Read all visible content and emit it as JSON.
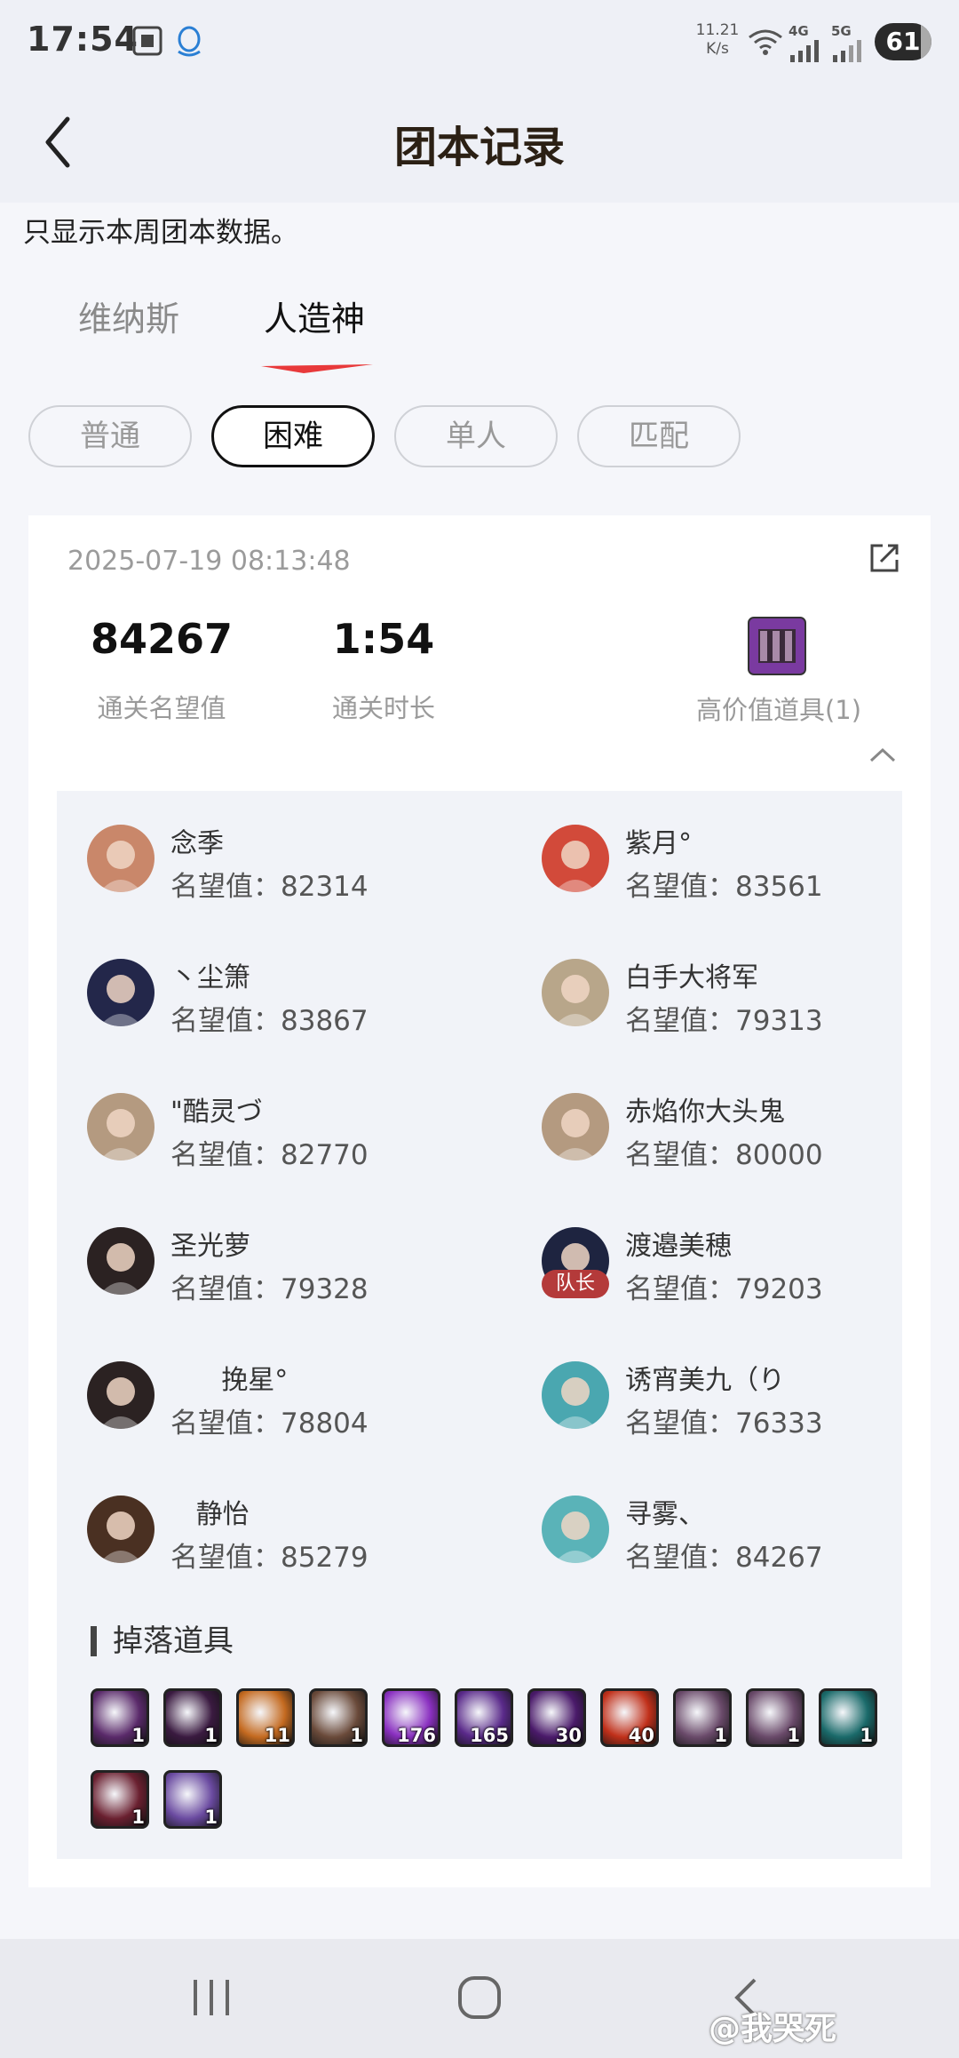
{
  "status_bar": {
    "time": "17:54",
    "net_speed_value": "11.21",
    "net_speed_unit": "K/s",
    "net_4g": "4G",
    "net_5g": "5G",
    "battery": "61",
    "icons": [
      "screenshot-icon",
      "qq-icon",
      "wifi-icon",
      "signal-4g-icon",
      "signal-5g-icon"
    ]
  },
  "header": {
    "title": "团本记录",
    "back_icon": "chevron-left-icon"
  },
  "notice": "只显示本周团本数据。",
  "tabs": [
    {
      "label": "维纳斯",
      "active": false
    },
    {
      "label": "人造神",
      "active": true
    }
  ],
  "difficulty_chips": [
    {
      "label": "普通",
      "selected": false
    },
    {
      "label": "困难",
      "selected": true
    },
    {
      "label": "单人",
      "selected": false
    },
    {
      "label": "匹配",
      "selected": false
    }
  ],
  "record": {
    "datetime": "2025-07-19 08:13:48",
    "clear_fame": {
      "value": "84267",
      "label": "通关名望值"
    },
    "clear_time": {
      "value": "1:54",
      "label": "通关时长"
    },
    "high_value_items": {
      "label": "高价值道具(1)"
    }
  },
  "players": [
    {
      "name": "念季",
      "score": "名望值：82314",
      "leader": false,
      "avatar_color": "#c9876a"
    },
    {
      "name": "紫月°",
      "score": "名望值：83561",
      "leader": false,
      "avatar_color": "#d24a3a"
    },
    {
      "name": "丶尘箫",
      "score": "名望值：83867",
      "leader": false,
      "avatar_color": "#23274a"
    },
    {
      "name": "白手大将军",
      "score": "名望值：79313",
      "leader": false,
      "avatar_color": "#b8a68a"
    },
    {
      "name": "\"酷灵づ",
      "score": "名望值：82770",
      "leader": false,
      "avatar_color": "#b49a80"
    },
    {
      "name": "赤焰你大头鬼",
      "score": "名望值：80000",
      "leader": false,
      "avatar_color": "#b49a80"
    },
    {
      "name": "圣光萝",
      "score": "名望值：79328",
      "leader": false,
      "avatar_color": "#2b2222"
    },
    {
      "name": "渡邉美穂",
      "score": "名望值：79203",
      "leader": true,
      "leader_label": "队长",
      "avatar_color": "#1e2440"
    },
    {
      "name": "      挽星°",
      "score": "名望值：78804",
      "leader": false,
      "avatar_color": "#2b2222"
    },
    {
      "name": "诱宵美九（り",
      "score": "名望值：76333",
      "leader": false,
      "avatar_color": "#4aa7b0"
    },
    {
      "name": "   静怡",
      "score": "名望值：85279",
      "leader": false,
      "avatar_color": "#4a3022"
    },
    {
      "name": "寻雾、",
      "score": "名望值：84267",
      "leader": false,
      "avatar_color": "#5ab3b8"
    }
  ],
  "drops": {
    "title": "掉落道具",
    "items": [
      {
        "qty": "1",
        "color": "#5a2a6a"
      },
      {
        "qty": "1",
        "color": "#3a1a40"
      },
      {
        "qty": "11",
        "color": "#c46a20"
      },
      {
        "qty": "1",
        "color": "#6a4a3a"
      },
      {
        "qty": "176",
        "color": "#8a30c0"
      },
      {
        "qty": "165",
        "color": "#5a2a8a"
      },
      {
        "qty": "30",
        "color": "#4a1a6a"
      },
      {
        "qty": "40",
        "color": "#c0301a"
      },
      {
        "qty": "1",
        "color": "#6a4a6a"
      },
      {
        "qty": "1",
        "color": "#6a4a6a"
      },
      {
        "qty": "1",
        "color": "#1a6a6a"
      },
      {
        "qty": "1",
        "color": "#6a2030"
      },
      {
        "qty": "1",
        "color": "#6a4aa0"
      }
    ]
  },
  "nav": {
    "buttons": [
      "recents-icon",
      "home-icon",
      "back-icon"
    ]
  },
  "watermark": "@我哭死"
}
